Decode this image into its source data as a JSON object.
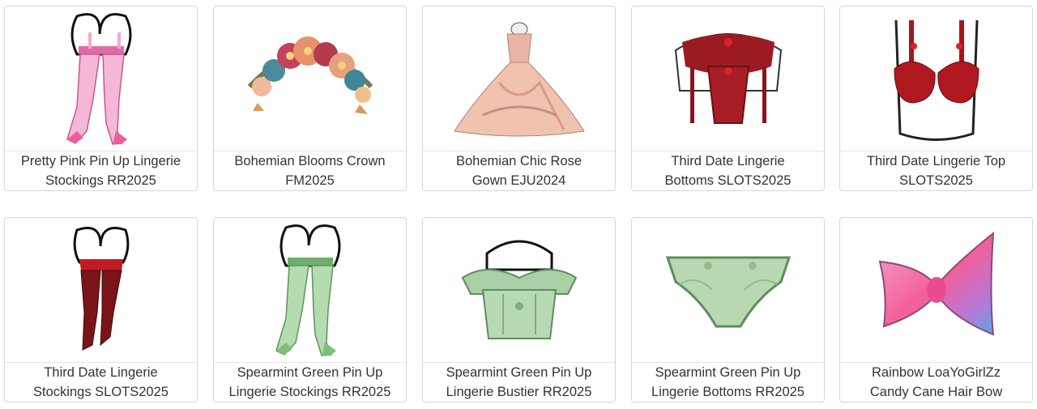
{
  "items": [
    {
      "line1": "Pretty Pink Pin Up Lingerie",
      "line2": "Stockings RR2025",
      "icon": "pink-stockings-icon",
      "color": "#f1a7cf"
    },
    {
      "line1": "Bohemian Blooms Crown",
      "line2": "FM2025",
      "icon": "flower-crown-icon",
      "color": "#d9777a"
    },
    {
      "line1": "Bohemian Chic Rose",
      "line2": "Gown EJU2024",
      "icon": "rose-gown-icon",
      "color": "#e9b7a4"
    },
    {
      "line1": "Third Date Lingerie",
      "line2": "Bottoms SLOTS2025",
      "icon": "red-garter-bottoms-icon",
      "color": "#9c1b22"
    },
    {
      "line1": "Third Date Lingerie Top",
      "line2": "SLOTS2025",
      "icon": "red-bra-top-icon",
      "color": "#a8141e"
    },
    {
      "line1": "Third Date Lingerie",
      "line2": "Stockings SLOTS2025",
      "icon": "red-stockings-icon",
      "color": "#7a1418"
    },
    {
      "line1": "Spearmint Green Pin Up",
      "line2": "Lingerie Stockings RR2025",
      "icon": "green-stockings-icon",
      "color": "#a9d4a4"
    },
    {
      "line1": "Spearmint Green Pin Up",
      "line2": "Lingerie Bustier RR2025",
      "icon": "green-bustier-icon",
      "color": "#a9cfa6"
    },
    {
      "line1": "Spearmint Green Pin Up",
      "line2": "Lingerie Bottoms RR2025",
      "icon": "green-bottoms-icon",
      "color": "#b8d8b2"
    },
    {
      "line1": "Rainbow LoaYoGirlZz",
      "line2": "Candy Cane Hair Bow",
      "icon": "rainbow-bow-icon",
      "color": "#f07aa8"
    }
  ]
}
